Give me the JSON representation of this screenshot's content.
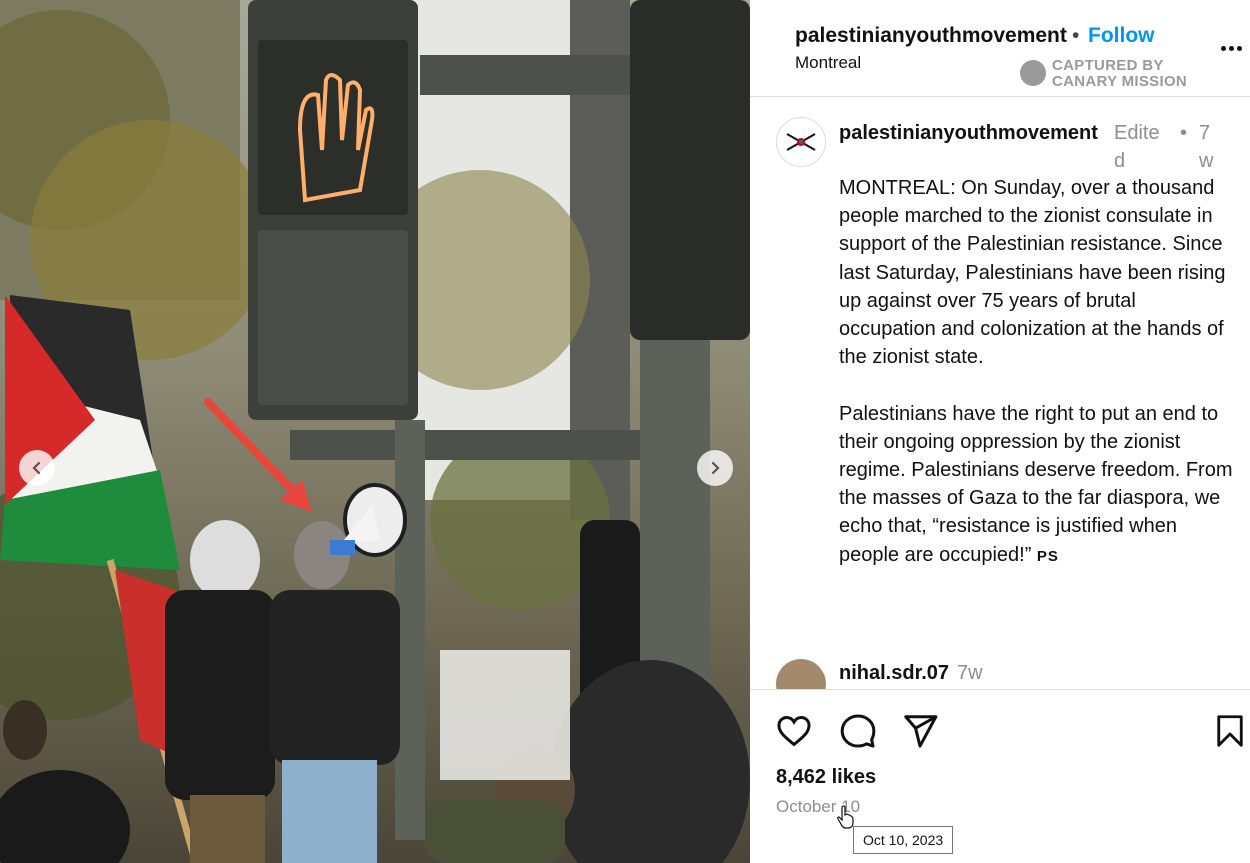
{
  "post": {
    "username": "palestinianyouthmovement",
    "follow_label": "Follow",
    "separator": "•",
    "location": "Montreal"
  },
  "watermark": {
    "line1": "CAPTURED BY",
    "line2": "CANARY MISSION"
  },
  "caption": {
    "username": "palestinianyouthmovement",
    "edited": "Edited",
    "separator": "•",
    "time": "7w",
    "paragraph1": "MONTREAL: On Sunday, over a thousand people marched to the zionist consulate in support of the Palestinian resistance. Since last Saturday, Palestinians have been rising up against over 75 years of brutal occupation and colonization at the hands of the zionist state.",
    "paragraph2": "Palestinians have the right to put an end to their ongoing oppression by the zionist regime. Palestinians deserve freedom. From the masses of Gaza to the far diaspora, we echo that, “resistance is justified when people are occupied!”",
    "signature": "PS"
  },
  "comment": {
    "username": "nihal.sdr.07",
    "time": "7w"
  },
  "actions": {
    "likes": "8,462 likes",
    "date": "October 10",
    "tooltip": "Oct 10, 2023"
  },
  "icons": {
    "prev": "chevron-left-icon",
    "next": "chevron-right-icon",
    "like": "heart-icon",
    "comment": "comment-bubble-icon",
    "share": "paper-plane-icon",
    "save": "bookmark-icon",
    "more": "more-options-icon"
  },
  "colors": {
    "link_blue": "#0095f6",
    "muted": "#8e8e8e",
    "arrow_red": "#e8453c"
  }
}
